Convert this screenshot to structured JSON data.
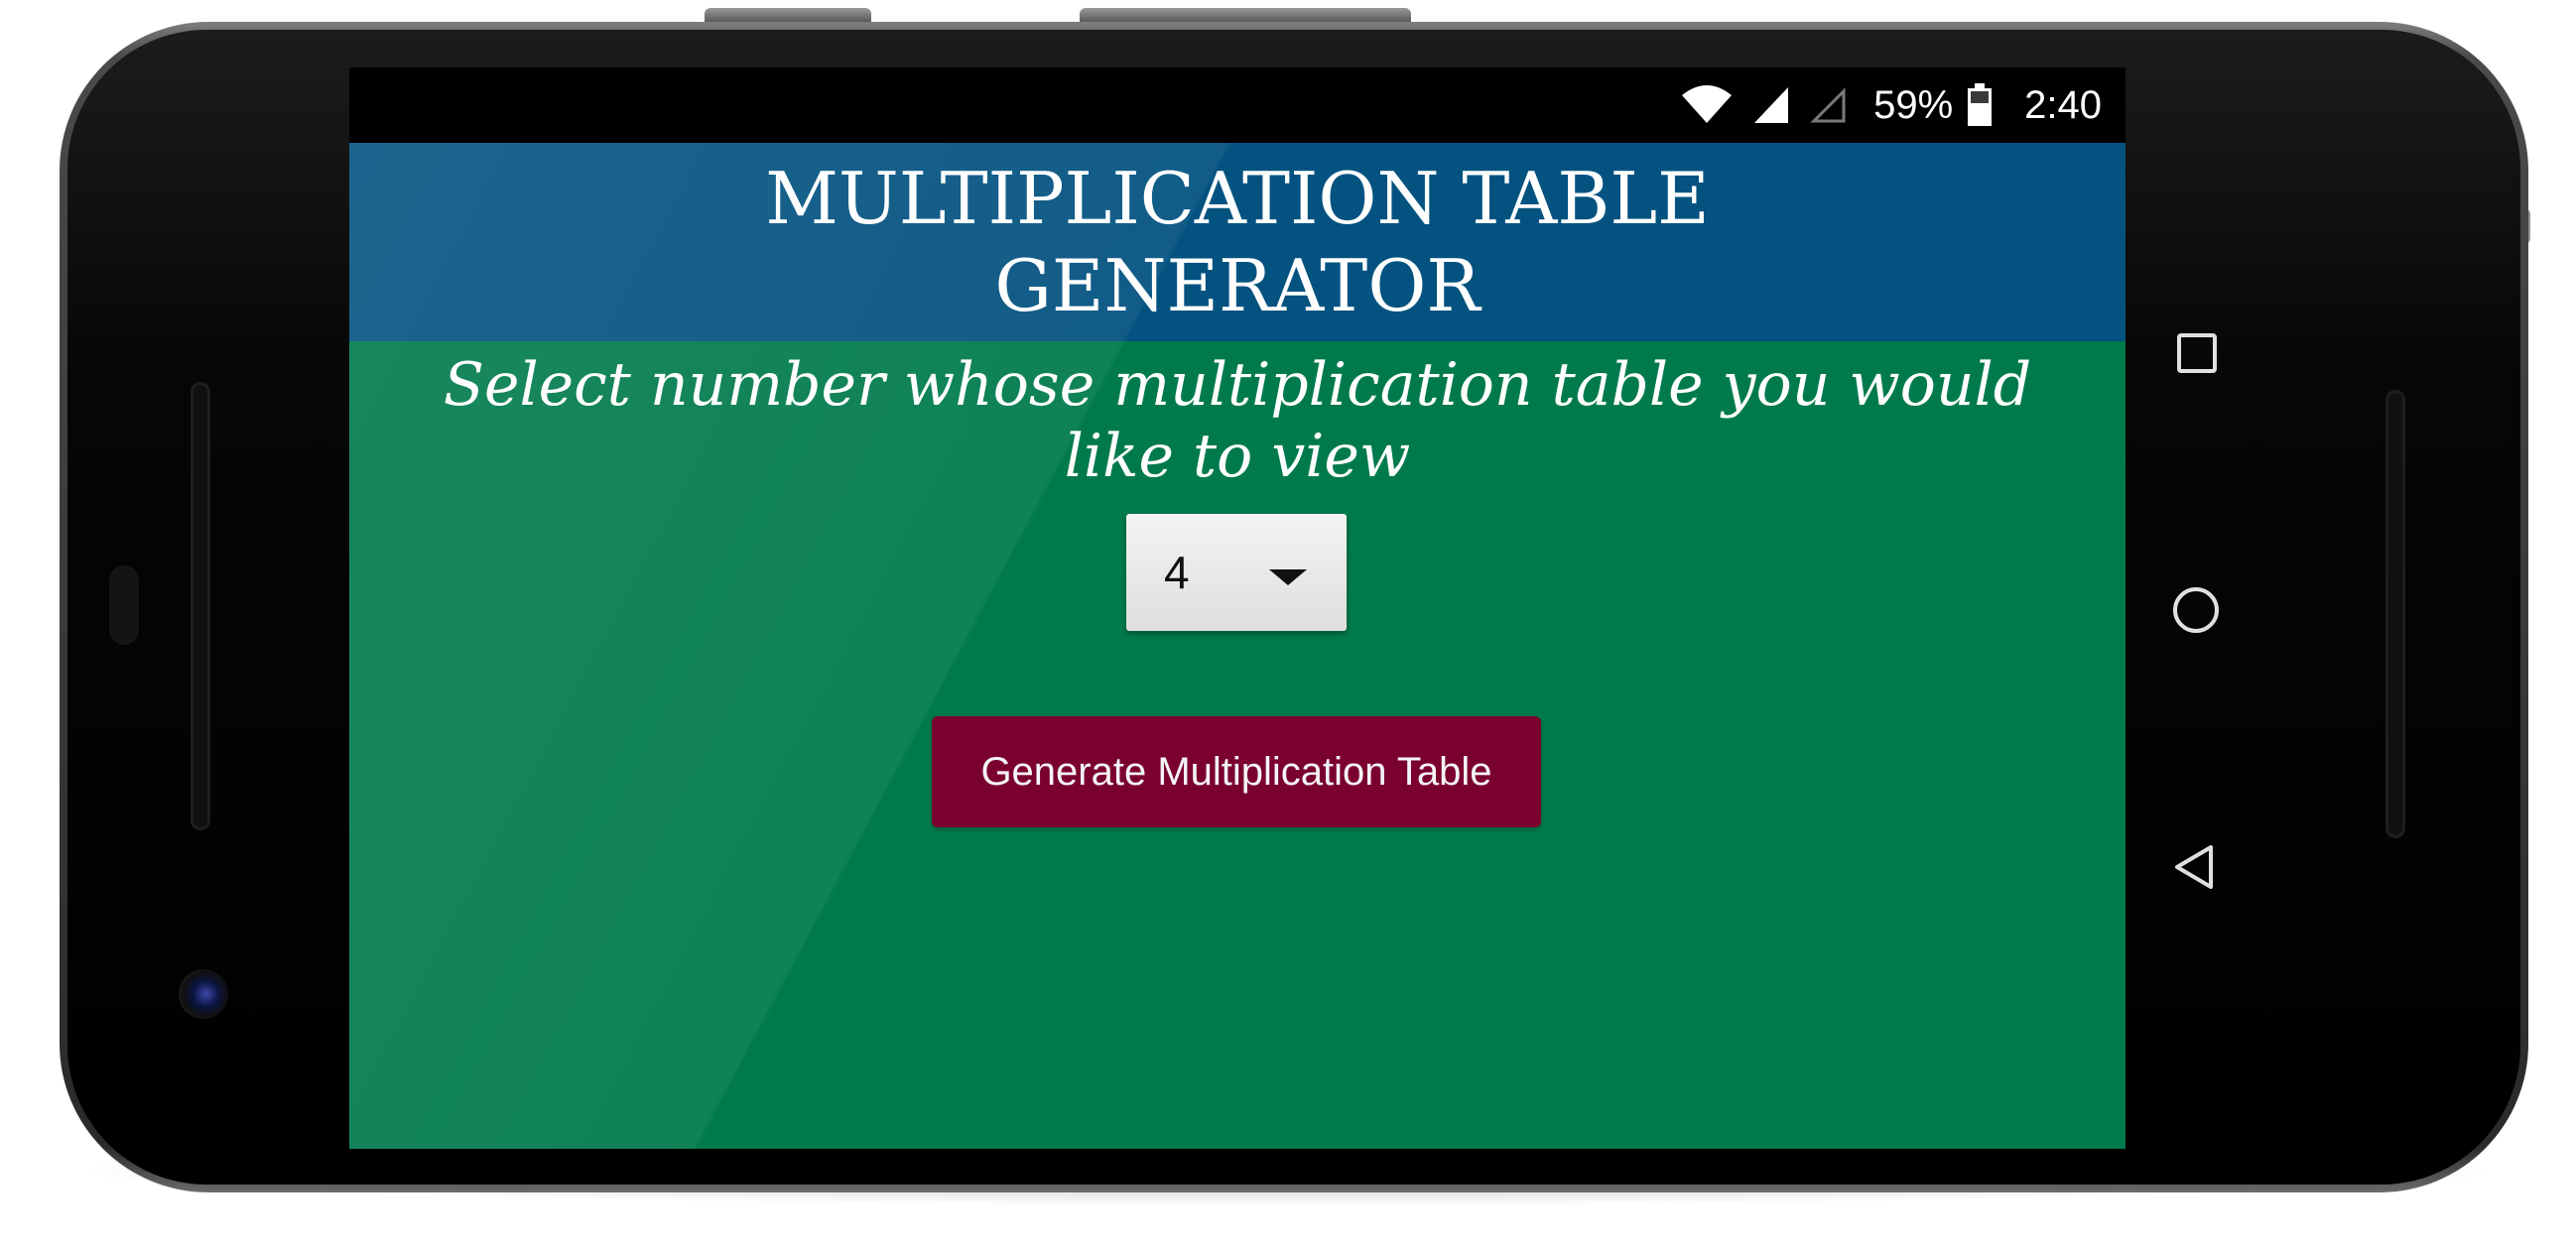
{
  "status_bar": {
    "battery_percent": "59%",
    "time": "2:40",
    "icons": [
      "wifi-icon",
      "cell-signal-icon",
      "cell-signal-empty-icon",
      "battery-icon"
    ]
  },
  "app": {
    "title": "MULTIPLICATION TABLE GENERATOR",
    "prompt": "Select number whose multiplication table you would like to view",
    "spinner": {
      "selected_value": "4",
      "icon": "dropdown-triangle-icon"
    },
    "generate_button_label": "Generate Multiplication Table"
  },
  "navigation_bar": {
    "icons": [
      "recent-apps-icon",
      "home-icon",
      "back-icon"
    ]
  },
  "colors": {
    "header_bg": "#035280",
    "body_bg": "#007A4C",
    "button_bg": "#7A0030",
    "text": "#FFFFFF"
  }
}
